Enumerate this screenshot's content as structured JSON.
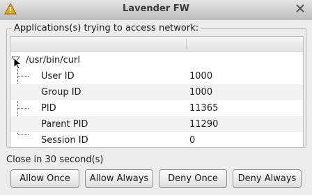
{
  "window": {
    "title": "Lavender FW"
  },
  "group": {
    "label": "Applications(s) trying to access network:"
  },
  "tree": {
    "root": "/usr/bin/curl",
    "rows": [
      {
        "key": "User ID",
        "value": "1000"
      },
      {
        "key": "Group ID",
        "value": "1000"
      },
      {
        "key": "PID",
        "value": "11365"
      },
      {
        "key": "Parent PID",
        "value": "11290"
      },
      {
        "key": "Session ID",
        "value": "0"
      }
    ]
  },
  "footer": {
    "countdown": "Close in 30 second(s)"
  },
  "buttons": {
    "allow_once": "Allow Once",
    "allow_always": "Allow Always",
    "deny_once": "Deny Once",
    "deny_always": "Deny Always"
  },
  "icons": {
    "title_left": "warning-icon",
    "title_right": "close-icon",
    "expander": "expander-down-icon",
    "cursor": "mouse-cursor-icon"
  },
  "colors": {
    "warning": "#e8a21b",
    "titlebar": "#d0d0d0",
    "row_alt": "#f2f2f2"
  }
}
